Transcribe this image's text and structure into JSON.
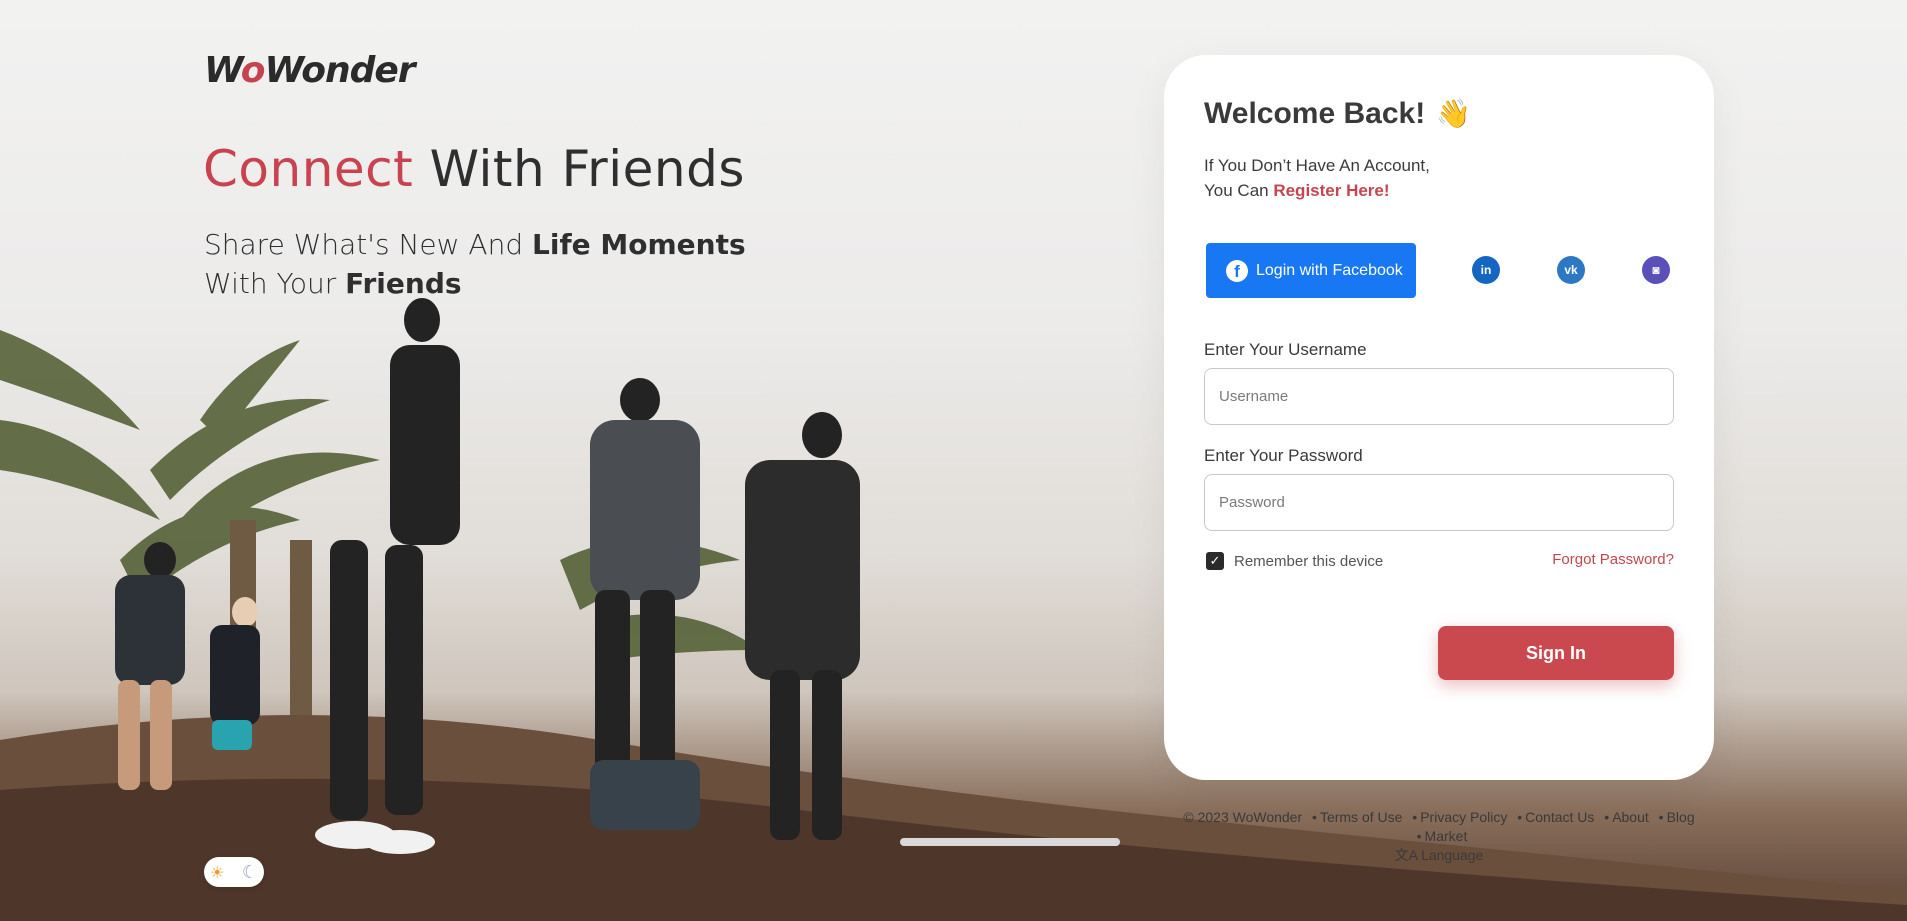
{
  "brand": {
    "logo_text_pre": "W",
    "logo_text_o": "o",
    "logo_text_post": "Wonder"
  },
  "hero": {
    "title_accent": "Connect",
    "title_rest": " With Friends",
    "sub_1": "Share What's New And ",
    "sub_bold_1": "Life Moments",
    "sub_2": " With Your ",
    "sub_bold_2": "Friends"
  },
  "login": {
    "title": "Welcome Back!",
    "wave_emoji": "👋",
    "desc_line1": "If You Don’t Have An Account,",
    "desc_line2": "You Can ",
    "register_link": "Register Here!",
    "facebook_label": "Login with Facebook",
    "facebook_glyph": "f",
    "linkedin_glyph": "in",
    "vk_glyph": "vk",
    "discord_glyph": "◙",
    "username_label": "Enter Your Username",
    "username_placeholder": "Username",
    "password_label": "Enter Your Password",
    "password_placeholder": "Password",
    "remember_label": "Remember this device",
    "remember_checked": true,
    "forgot_label": "Forgot Password?",
    "signin_label": "Sign In"
  },
  "footer": {
    "copyright": "© 2023 WoWonder",
    "links": [
      "Terms of Use",
      "Privacy Policy",
      "Contact Us",
      "About",
      "Blog",
      "Market"
    ],
    "language_icon": "文A",
    "language_label": "Language"
  },
  "theme": {
    "sun_icon": "☀",
    "moon_icon": "☾"
  },
  "colors": {
    "accent": "#c8434f",
    "facebook": "#1877f2",
    "linkedin": "#1466c1",
    "vk": "#2d78c4",
    "discord": "#5b50b9"
  }
}
